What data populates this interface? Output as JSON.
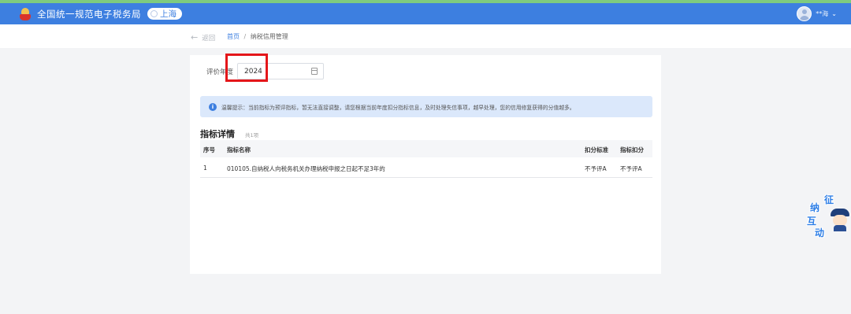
{
  "header": {
    "app_title": "全国统一规范电子税务局",
    "region": "上海",
    "username": "**海",
    "user_menu_caret": "⌄"
  },
  "breadcrumb": {
    "back_label": "返回",
    "back_arrow": "←",
    "home": "首页",
    "separator": "/",
    "current": "纳税信用管理"
  },
  "filter": {
    "year_label": "评价年度",
    "year_value": "2024"
  },
  "notice": {
    "icon": "i",
    "text": "温馨提示：当前指标为预评指标，暂无法直接调整，请您根据当前年度扣分指标信息，及时处理失信事项，越早处理，您的信用修复获得的分值越多。"
  },
  "section": {
    "title": "指标详情",
    "count": "共1项"
  },
  "table": {
    "columns": [
      "序号",
      "指标名称",
      "扣分标准",
      "指标扣分"
    ],
    "rows": [
      [
        "1",
        "010105.自纳税人向税务机关办理纳税申报之日起不足3年的",
        "不予评A",
        "不予评A"
      ]
    ]
  },
  "mascot": {
    "chars": [
      "征",
      "纳",
      "互",
      "动"
    ]
  },
  "colors": {
    "header_bg": "#3d7fe0",
    "highlight": "#e4161a",
    "notice_bg": "#dbe8fb"
  }
}
